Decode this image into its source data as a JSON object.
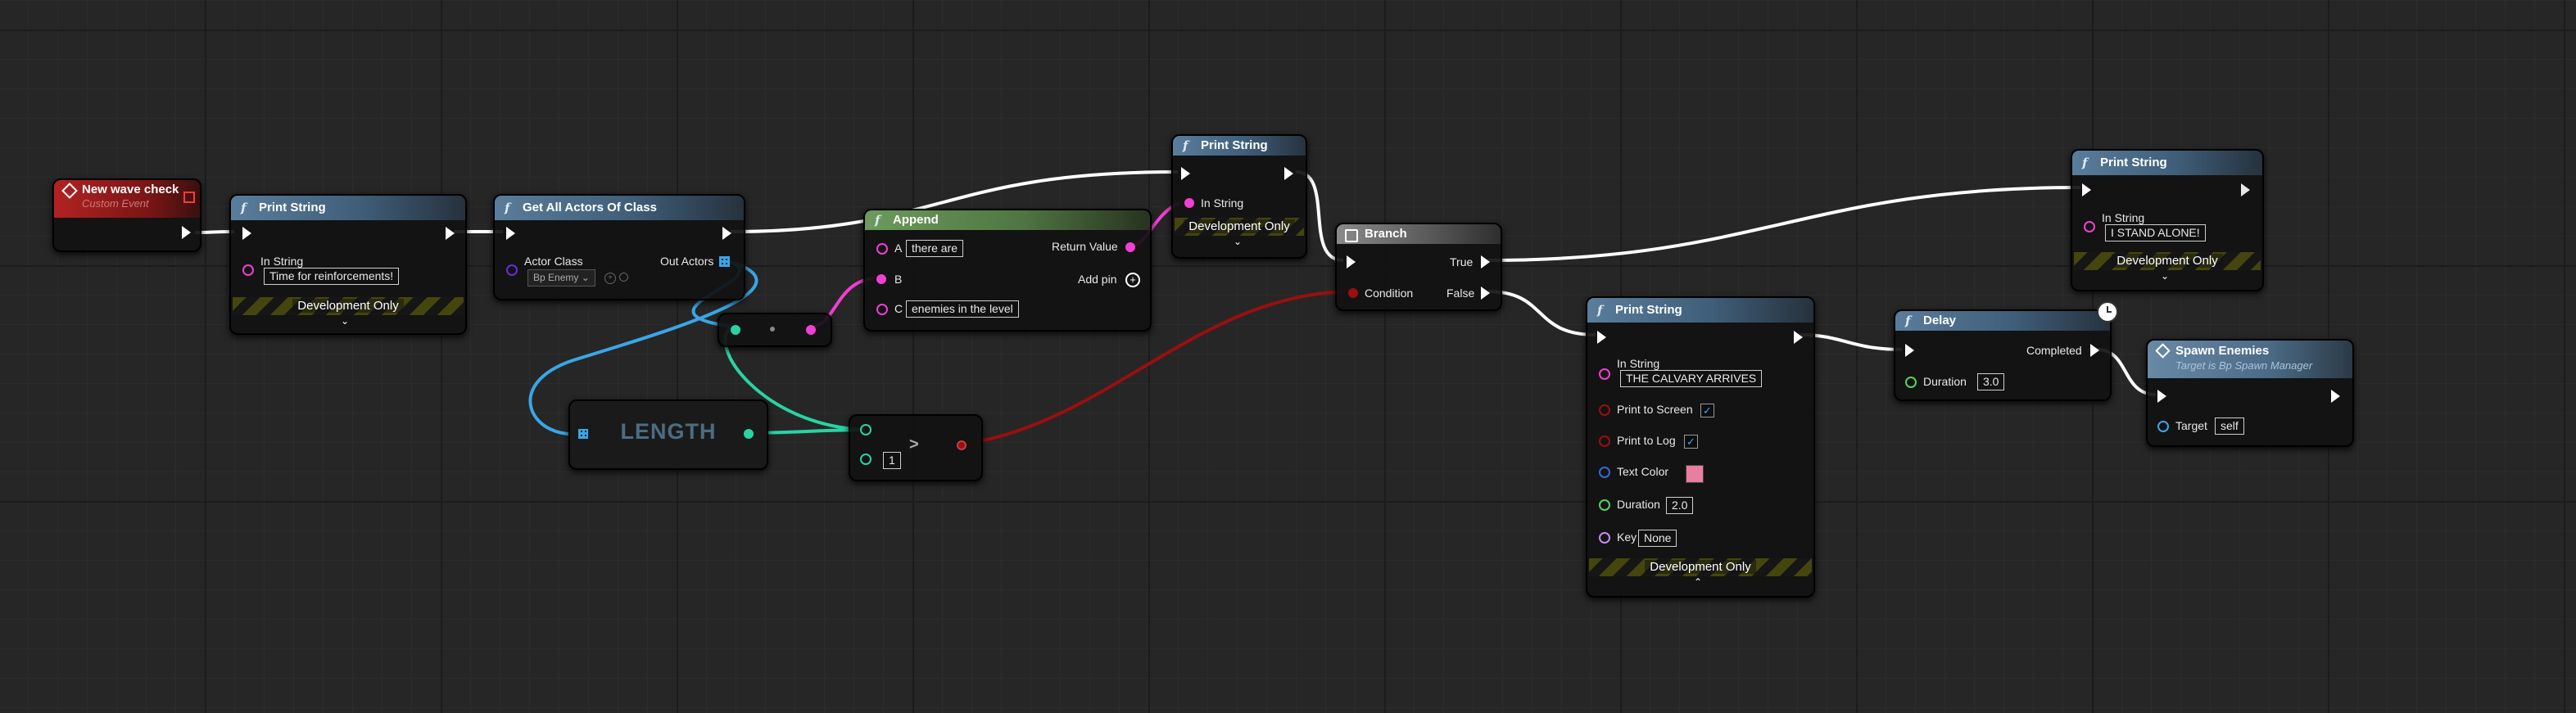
{
  "nodes": {
    "custom_event": {
      "title": "New wave check",
      "subtitle": "Custom Event"
    },
    "print1": {
      "title": "Print String",
      "in_string_label": "In String",
      "in_string_value": "Time for reinforcements!",
      "footer": "Development Only"
    },
    "get_all_actors": {
      "title": "Get All Actors Of Class",
      "actor_class_label": "Actor Class",
      "actor_class_value": "Bp Enemy",
      "out_actors_label": "Out Actors"
    },
    "append": {
      "title": "Append",
      "a_label": "A",
      "a_value": "there are",
      "b_label": "B",
      "c_label": "C",
      "c_value": "enemies in the level",
      "return_label": "Return Value",
      "addpin_label": "Add pin"
    },
    "print2": {
      "title": "Print String",
      "in_string_label": "In String",
      "footer": "Development Only"
    },
    "branch": {
      "title": "Branch",
      "condition_label": "Condition",
      "true_label": "True",
      "false_label": "False"
    },
    "length": {
      "title": "LENGTH"
    },
    "compare": {
      "operator": ">",
      "value": "1"
    },
    "print3": {
      "title": "Print String",
      "in_string_label": "In String",
      "in_string_value": "I STAND ALONE!",
      "footer": "Development Only"
    },
    "print4": {
      "title": "Print String",
      "in_string_label": "In String",
      "in_string_value": "THE CALVARY ARRIVES",
      "print_screen_label": "Print to Screen",
      "print_log_label": "Print to Log",
      "text_color_label": "Text Color",
      "text_color_value": "#e87fa0",
      "duration_label": "Duration",
      "duration_value": "2.0",
      "key_label": "Key",
      "key_value": "None",
      "footer": "Development Only"
    },
    "delay": {
      "title": "Delay",
      "completed_label": "Completed",
      "duration_label": "Duration",
      "duration_value": "3.0"
    },
    "spawn": {
      "title": "Spawn Enemies",
      "subtitle": "Target is Bp Spawn Manager",
      "target_label": "Target",
      "target_value": "self"
    }
  },
  "colors": {
    "exec_wire": "#ffffff",
    "string_pin": "#f03fd2",
    "array_pin": "#3aa6e6",
    "int_pin": "#29d3a4",
    "bool_pin": "#9a0f0f",
    "float_pin": "#58d25b",
    "color_pin": "#2f6bd9",
    "name_pin": "#c58cf0",
    "object_pin": "#3aa6e6",
    "class_pin": "#6d2bd9"
  },
  "icons": {
    "event": "diamond-icon",
    "function": "function-f-icon",
    "branch": "branch-icon",
    "delay": "clock-icon",
    "addpin": "plus-circle-icon",
    "array": "grid-icon",
    "dropdown": "chevron-down-icon",
    "browse": "magnifier-icon"
  }
}
